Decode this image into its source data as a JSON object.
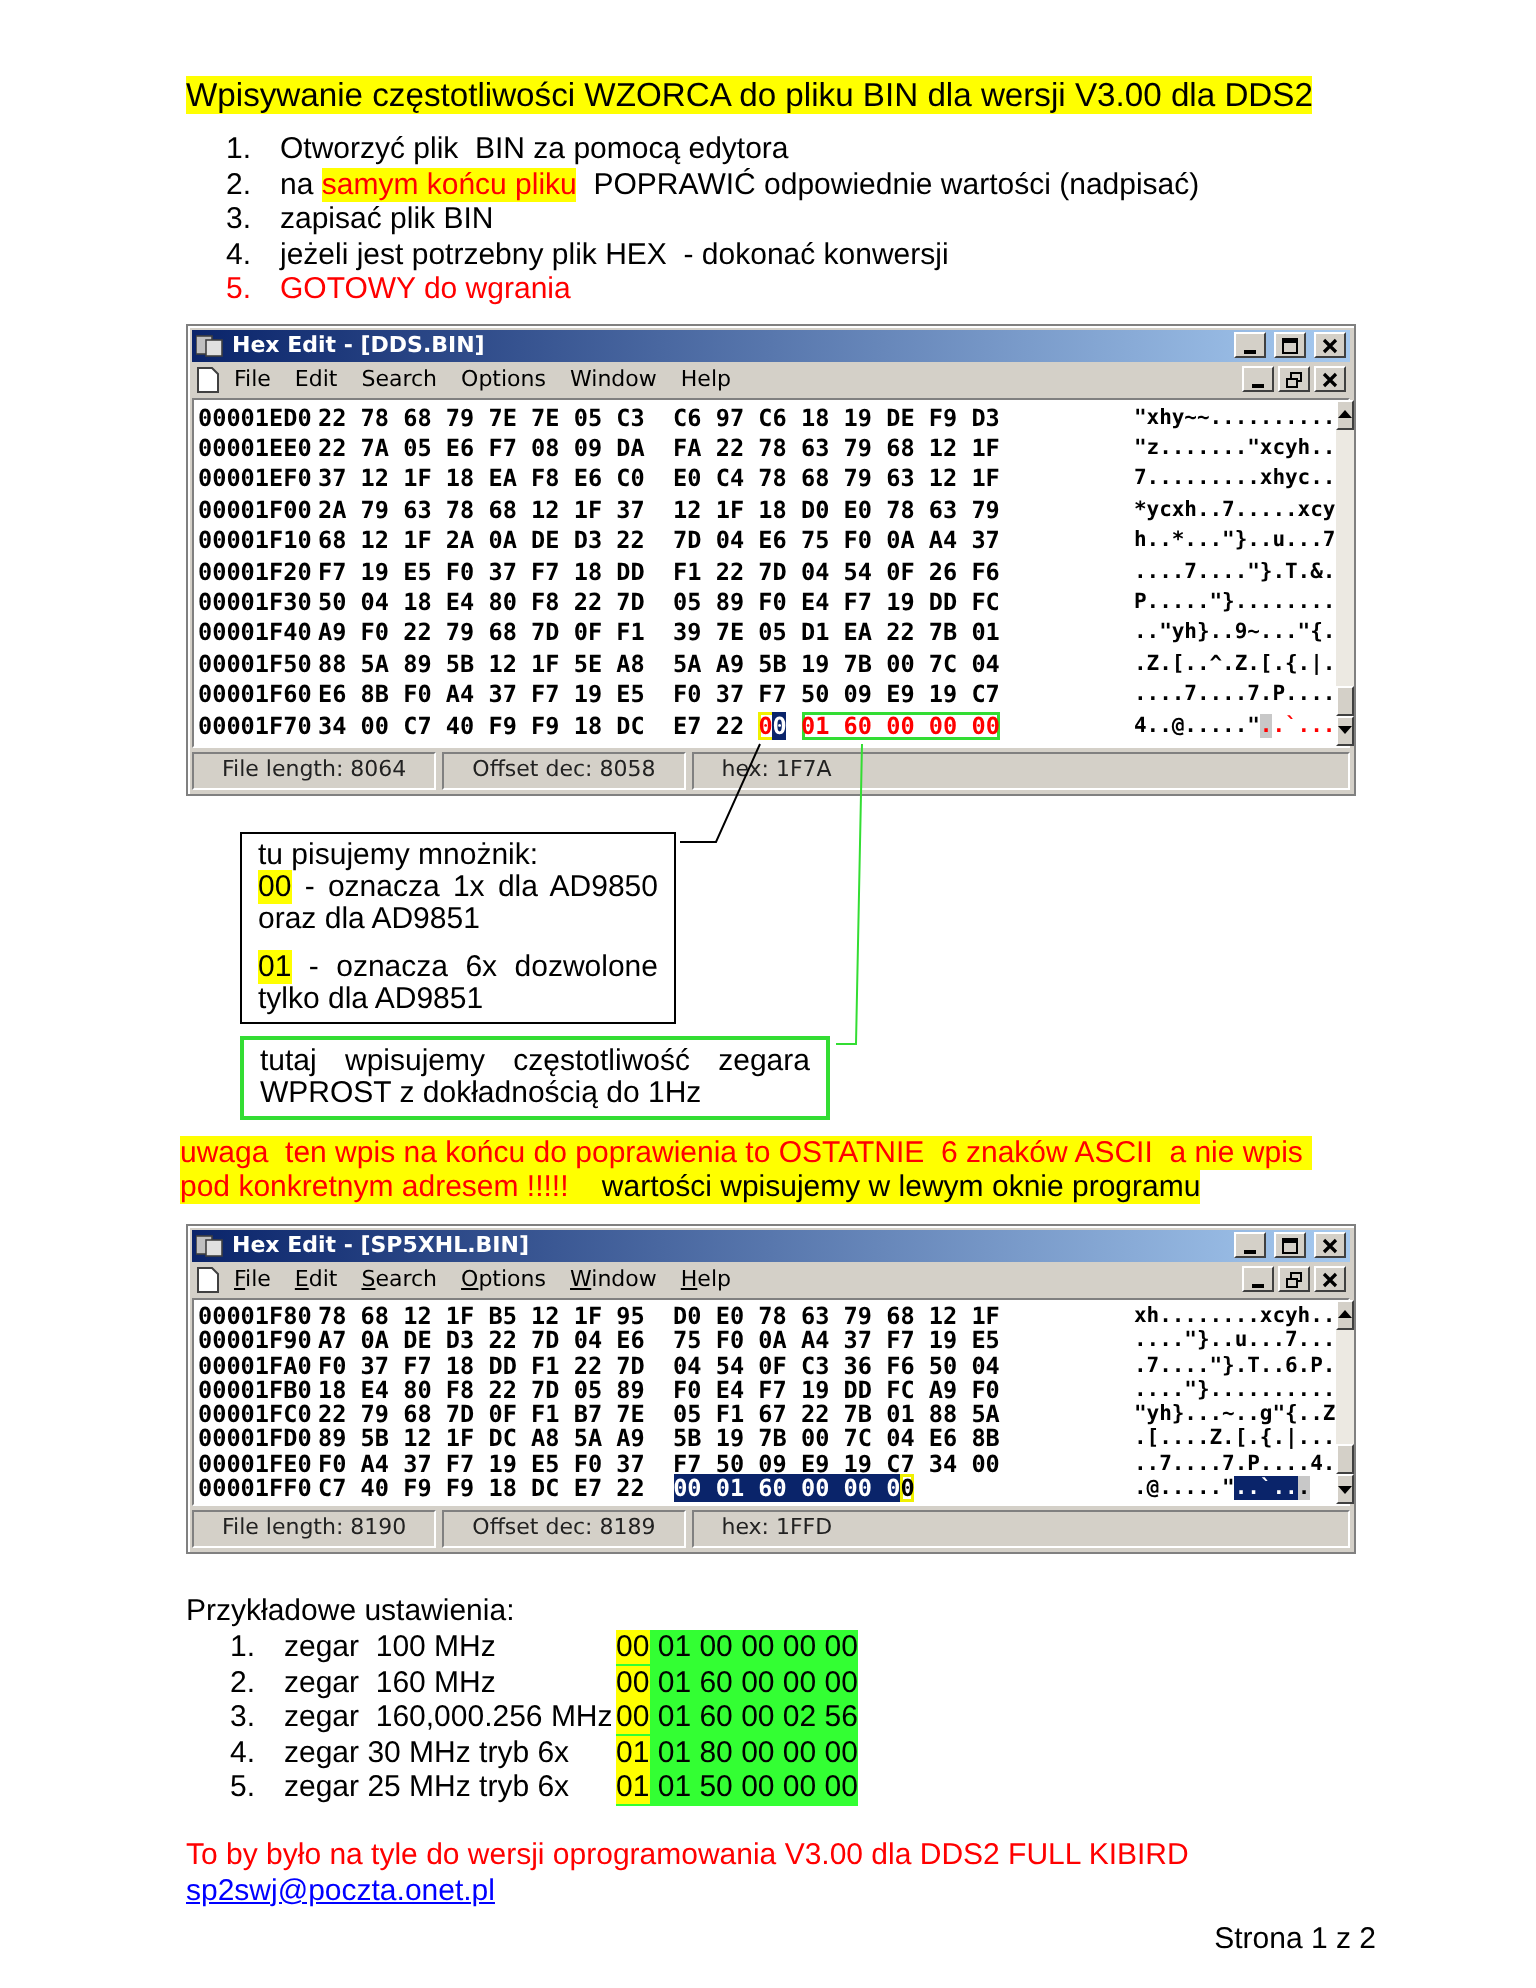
{
  "title": "Wpisywanie  częstotliwości  WZORCA  do pliku BIN dla wersji V3.00 dla DDS2",
  "steps": [
    {
      "number": "1.",
      "emphasis": false,
      "parts": [
        {
          "text": "Otworzyć plik  BIN za pomocą edytora",
          "kind": "plain"
        }
      ]
    },
    {
      "number": "2.",
      "emphasis": false,
      "parts": [
        {
          "text": "na ",
          "kind": "plain"
        },
        {
          "text": "samym końcu pliku",
          "kind": "mark"
        },
        {
          "text": "  POPRAWIĆ odpowiednie wartości (nadpisać)",
          "kind": "plain"
        }
      ]
    },
    {
      "number": "3.",
      "emphasis": false,
      "parts": [
        {
          "text": "zapisać plik BIN",
          "kind": "plain"
        }
      ]
    },
    {
      "number": "4.",
      "emphasis": false,
      "parts": [
        {
          "text": "jeżeli jest potrzebny plik HEX  - dokonać konwersji",
          "kind": "plain"
        }
      ]
    },
    {
      "number": "5.",
      "emphasis": true,
      "parts": [
        {
          "text": "GOTOWY do wgrania",
          "kind": "plain"
        }
      ]
    }
  ],
  "windows": [
    {
      "title": "Hex Edit - [DDS.BIN]",
      "menu_mnemonics": false,
      "menu": [
        "File",
        "Edit",
        "Search",
        "Options",
        "Window",
        "Help"
      ],
      "rows": [
        {
          "offset": "00001ED0",
          "hex": [
            {
              "kind": "plain",
              "text": "22 78 68 79 7E 7E 05 C3  C6 97 C6 18 19 DE F9 D3"
            }
          ],
          "ascii": [
            {
              "kind": "plain",
              "text": "\"xhy~~.........."
            }
          ]
        },
        {
          "offset": "00001EE0",
          "hex": [
            {
              "kind": "plain",
              "text": "22 7A 05 E6 F7 08 09 DA  FA 22 78 63 79 68 12 1F"
            }
          ],
          "ascii": [
            {
              "kind": "plain",
              "text": "\"z.......\"xcyh.."
            }
          ]
        },
        {
          "offset": "00001EF0",
          "hex": [
            {
              "kind": "plain",
              "text": "37 12 1F 18 EA F8 E6 C0  E0 C4 78 68 79 63 12 1F"
            }
          ],
          "ascii": [
            {
              "kind": "plain",
              "text": "7.........xhyc.."
            }
          ]
        },
        {
          "offset": "00001F00",
          "hex": [
            {
              "kind": "plain",
              "text": "2A 79 63 78 68 12 1F 37  12 1F 18 D0 E0 78 63 79"
            }
          ],
          "ascii": [
            {
              "kind": "plain",
              "text": "*ycxh..7.....xcy"
            }
          ]
        },
        {
          "offset": "00001F10",
          "hex": [
            {
              "kind": "plain",
              "text": "68 12 1F 2A 0A DE D3 22  7D 04 E6 75 F0 0A A4 37"
            }
          ],
          "ascii": [
            {
              "kind": "plain",
              "text": "h..*...\"}..u...7"
            }
          ]
        },
        {
          "offset": "00001F20",
          "hex": [
            {
              "kind": "plain",
              "text": "F7 19 E5 F0 37 F7 18 DD  F1 22 7D 04 54 0F 26 F6"
            }
          ],
          "ascii": [
            {
              "kind": "plain",
              "text": "....7....\"}.T.&."
            }
          ]
        },
        {
          "offset": "00001F30",
          "hex": [
            {
              "kind": "plain",
              "text": "50 04 18 E4 80 F8 22 7D  05 89 F0 E4 F7 19 DD FC"
            }
          ],
          "ascii": [
            {
              "kind": "plain",
              "text": "P.....\"}........"
            }
          ]
        },
        {
          "offset": "00001F40",
          "hex": [
            {
              "kind": "plain",
              "text": "A9 F0 22 79 68 7D 0F F1  39 7E 05 D1 EA 22 7B 01"
            }
          ],
          "ascii": [
            {
              "kind": "plain",
              "text": "..\"yh}..9~...\"{."
            }
          ]
        },
        {
          "offset": "00001F50",
          "hex": [
            {
              "kind": "plain",
              "text": "88 5A 89 5B 12 1F 5E A8  5A A9 5B 19 7B 00 7C 04"
            }
          ],
          "ascii": [
            {
              "kind": "plain",
              "text": ".Z.[..^.Z.[.{.|."
            }
          ]
        },
        {
          "offset": "00001F60",
          "hex": [
            {
              "kind": "plain",
              "text": "E6 8B F0 A4 37 F7 19 E5  F0 37 F7 50 09 E9 19 C7"
            }
          ],
          "ascii": [
            {
              "kind": "plain",
              "text": "....7....7.P...."
            }
          ]
        },
        {
          "offset": "00001F70",
          "hex": [
            {
              "kind": "plain",
              "text": "34 00 C7 40 F9 F9 18 DC  E7 22 "
            },
            {
              "kind": "marked",
              "children": [
                {
                  "kind": "red",
                  "text": "0"
                },
                {
                  "kind": "cursor",
                  "text": "0"
                }
              ]
            },
            {
              "kind": "boxed",
              "children": [
                {
                  "kind": "red",
                  "text": "01 60 00 00 00"
                }
              ]
            }
          ],
          "ascii": [
            {
              "kind": "plain",
              "text": "4..@.....\""
            },
            {
              "kind": "red-dim",
              "text": "."
            },
            {
              "kind": "red",
              "text": ".`..."
            }
          ]
        }
      ],
      "status": [
        "File length: 8064",
        "Offset dec: 8058",
        "hex: 1F7A"
      ]
    },
    {
      "title": "Hex Edit - [SP5XHL.BIN]",
      "menu_mnemonics": true,
      "menu": [
        "File",
        "Edit",
        "Search",
        "Options",
        "Window",
        "Help"
      ],
      "rows": [
        {
          "offset": "00001F80",
          "hex": [
            {
              "kind": "plain",
              "text": "78 68 12 1F B5 12 1F 95  D0 E0 78 63 79 68 12 1F"
            }
          ],
          "ascii": [
            {
              "kind": "plain",
              "text": "xh........xcyh.."
            }
          ]
        },
        {
          "offset": "00001F90",
          "hex": [
            {
              "kind": "plain",
              "text": "A7 0A DE D3 22 7D 04 E6  75 F0 0A A4 37 F7 19 E5"
            }
          ],
          "ascii": [
            {
              "kind": "plain",
              "text": "....\"}..u...7..."
            }
          ]
        },
        {
          "offset": "00001FA0",
          "hex": [
            {
              "kind": "plain",
              "text": "F0 37 F7 18 DD F1 22 7D  04 54 0F C3 36 F6 50 04"
            }
          ],
          "ascii": [
            {
              "kind": "plain",
              "text": ".7....\"}.T..6.P."
            }
          ]
        },
        {
          "offset": "00001FB0",
          "hex": [
            {
              "kind": "plain",
              "text": "18 E4 80 F8 22 7D 05 89  F0 E4 F7 19 DD FC A9 F0"
            }
          ],
          "ascii": [
            {
              "kind": "plain",
              "text": "....\"}.........."
            }
          ]
        },
        {
          "offset": "00001FC0",
          "hex": [
            {
              "kind": "plain",
              "text": "22 79 68 7D 0F F1 B7 7E  05 F1 67 22 7B 01 88 5A"
            }
          ],
          "ascii": [
            {
              "kind": "plain",
              "text": "\"yh}...~..g\"{..Z"
            }
          ]
        },
        {
          "offset": "00001FD0",
          "hex": [
            {
              "kind": "plain",
              "text": "89 5B 12 1F DC A8 5A A9  5B 19 7B 00 7C 04 E6 8B"
            }
          ],
          "ascii": [
            {
              "kind": "plain",
              "text": ".[....Z.[.{.|..."
            }
          ]
        },
        {
          "offset": "00001FE0",
          "hex": [
            {
              "kind": "plain",
              "text": "F0 A4 37 F7 19 E5 F0 37  F7 50 09 E9 19 C7 34 00"
            }
          ],
          "ascii": [
            {
              "kind": "plain",
              "text": "..7....7.P....4."
            }
          ]
        },
        {
          "offset": "00001FF0",
          "hex": [
            {
              "kind": "plain",
              "text": "C7 40 F9 F9 18 DC E7 22  "
            },
            {
              "kind": "selected",
              "text": "00 01 60 00 00 0"
            },
            {
              "kind": "marked",
              "children": [
                {
                  "kind": "plain",
                  "text": "0"
                }
              ]
            }
          ],
          "ascii": [
            {
              "kind": "plain",
              "text": ".@.....\""
            },
            {
              "kind": "selected",
              "text": "..`.."
            },
            {
              "kind": "dim",
              "text": "."
            }
          ]
        }
      ],
      "status": [
        "File length: 8190",
        "Offset dec: 8189",
        "hex: 1FFD"
      ]
    }
  ],
  "notes": [
    {
      "kind": "multiplier",
      "lines": [
        [
          {
            "text": "tu pisujemy mnożnik:",
            "kind": "plain"
          }
        ],
        [
          {
            "text": "00",
            "kind": "code"
          },
          {
            "text": " - oznacza 1x dla AD9850 oraz dla AD9851",
            "kind": "plain"
          }
        ],
        [
          {
            "text": "01",
            "kind": "code"
          },
          {
            "text": " - oznacza 6x dozwolone tylko dla AD9851",
            "kind": "plain"
          }
        ]
      ]
    },
    {
      "kind": "frequency",
      "lines": [
        [
          {
            "text": "tutaj wpisujemy częstotliwość zegara WPROST z dokładnością do 1Hz",
            "kind": "plain"
          }
        ]
      ]
    }
  ],
  "warning": [
    {
      "text": "uwaga  ten wpis na końcu do poprawienia to OSTATNIE  6 znaków ASCII  a nie wpis pod konkretnym adresem !!!!!",
      "emphasis": true
    },
    {
      "text": "    wartości wpisujemy w lewym oknie programu",
      "emphasis": false
    }
  ],
  "examples": {
    "heading": "Przykładowe ustawienia:",
    "items": [
      {
        "number": "1.",
        "label": "zegar  100 MHz",
        "multiplier": "00",
        "frequency": "01 00 00 00 00"
      },
      {
        "number": "2.",
        "label": "zegar  160 MHz",
        "multiplier": "00",
        "frequency": "01 60 00 00 00"
      },
      {
        "number": "3.",
        "label": "zegar  160,000.256 MHz",
        "multiplier": "00",
        "frequency": "01 60 00 02 56"
      },
      {
        "number": "4.",
        "label": "zegar 30 MHz tryb 6x",
        "multiplier": "01",
        "frequency": "01 80 00 00 00"
      },
      {
        "number": "5.",
        "label": "zegar 25 MHz tryb 6x",
        "multiplier": "01",
        "frequency": "01 50 00 00 00"
      }
    ]
  },
  "footer": {
    "text": "To by było na tyle do wersji oprogramowania V3.00 dla DDS2 FULL KIBIRD",
    "email": "sp2swj@poczta.onet.pl",
    "page": "Strona 1 z 2"
  }
}
